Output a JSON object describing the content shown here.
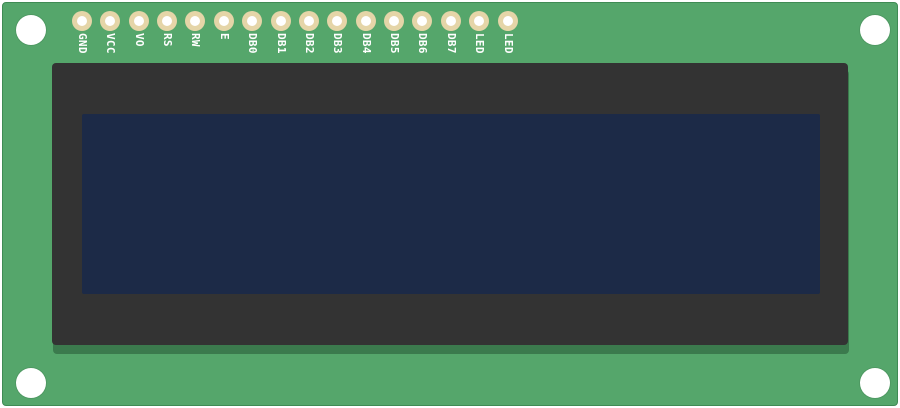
{
  "module": {
    "pins": [
      {
        "label": "GND"
      },
      {
        "label": "VCC"
      },
      {
        "label": "VO"
      },
      {
        "label": "RS"
      },
      {
        "label": "RW"
      },
      {
        "label": "E"
      },
      {
        "label": "DB0"
      },
      {
        "label": "DB1"
      },
      {
        "label": "DB2"
      },
      {
        "label": "DB3"
      },
      {
        "label": "DB4"
      },
      {
        "label": "DB5"
      },
      {
        "label": "DB6"
      },
      {
        "label": "DB7"
      },
      {
        "label": "LED"
      },
      {
        "label": "LED"
      }
    ]
  },
  "colors": {
    "pcb": "#55a66b",
    "bezel": "#333333",
    "screen": "#1c2a47",
    "pin_pad": "#e5d5a8",
    "label_text": "#ffffff"
  }
}
